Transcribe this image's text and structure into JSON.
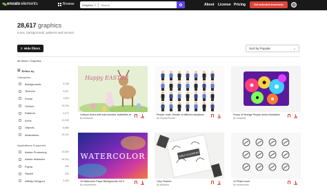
{
  "topbar": {
    "logo_main": "envato",
    "logo_sub": "elements",
    "browse_label": "Browse",
    "search_category": "Graphics",
    "search_placeholder": "Search",
    "nav": [
      "About",
      "License",
      "Pricing"
    ],
    "cta_label": "Get unlimited downloads"
  },
  "header": {
    "count": "28,617",
    "title_word": "graphics",
    "subtitle": "Icons, backgrounds, patterns and vectors",
    "hide_filters_label": "Hide filters",
    "sort_label": "Sort by Popular",
    "breadcrumb": "All Items / Graphics"
  },
  "sidebar": {
    "refine_label": "Refine by",
    "categories_heading": "Categories",
    "categories": [
      {
        "label": "Backgrounds",
        "count": "3,108"
      },
      {
        "label": "Textures",
        "count": "2,507"
      },
      {
        "label": "Social",
        "count": "1,694"
      },
      {
        "label": "Vectors",
        "count": "76,253"
      },
      {
        "label": "Patterns",
        "count": "3,972"
      },
      {
        "label": "Icons",
        "count": "11,290"
      },
      {
        "label": "Objects",
        "count": "6,880"
      },
      {
        "label": "Illustrations",
        "count": "15,441"
      }
    ],
    "apps_heading": "Applications Supported",
    "apps": [
      {
        "label": "Adobe Photoshop",
        "count": "10,849"
      },
      {
        "label": "Adobe Illustrator",
        "count": "18,204"
      },
      {
        "label": "Figma",
        "count": "336"
      },
      {
        "label": "Sketch",
        "count": "340"
      },
      {
        "label": "Affinity Designer",
        "count": "2,453"
      }
    ]
  },
  "cards": [
    {
      "title": "Cartoon Deers with cute bunnies, butterflies and eggs",
      "author": "By drawlaces",
      "art": "easter",
      "art_text": "Happy EASTER"
    },
    {
      "title": "People, male, female, in different situations",
      "author": "By GraphicPictures",
      "art": "people",
      "art_text": ""
    },
    {
      "title": "Group of Strange People vector illustration",
      "author": "By Jamjamia",
      "art": "strange",
      "art_text": ""
    },
    {
      "title": "16 Watercolor Paper Backgrounds Vol.3",
      "author": "By creativefinder",
      "art": "watercolor",
      "art_text": "WATERCOLOR"
    },
    {
      "title": "Grey Flowers",
      "author": "By Mabasha",
      "art": "flowers",
      "art_text": "GREY FLOWERS"
    },
    {
      "title": "12 Pirate Icons",
      "author": "By creativenode",
      "art": "pirate",
      "art_text": ""
    }
  ],
  "colors": {
    "topbar_bg": "#191919",
    "search_button": "#5b45f5",
    "cta_bg": "#e2453c",
    "accent_red": "#e2453c",
    "logo_green": "#82b541"
  }
}
